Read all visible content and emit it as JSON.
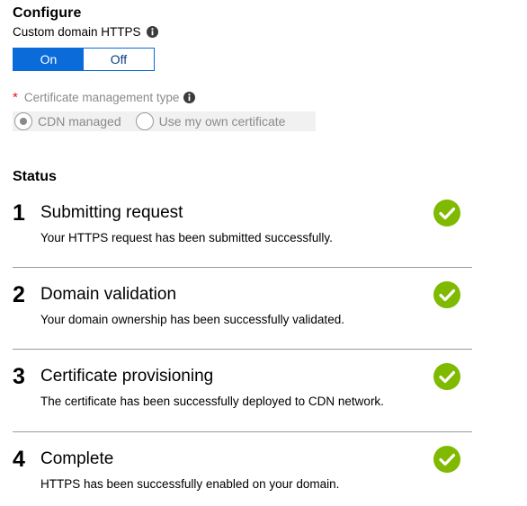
{
  "configure": {
    "title": "Configure",
    "https_label": "Custom domain HTTPS",
    "https_toggle": {
      "on_label": "On",
      "off_label": "Off",
      "selected": "On"
    },
    "cert_type_label": "Certificate management type",
    "required_marker": "*",
    "cert_options": [
      {
        "label": "CDN managed",
        "selected": true
      },
      {
        "label": "Use my own certificate",
        "selected": false
      }
    ]
  },
  "status": {
    "title": "Status",
    "steps": [
      {
        "number": "1",
        "title": "Submitting request",
        "description": "Your HTTPS request has been submitted successfully."
      },
      {
        "number": "2",
        "title": "Domain validation",
        "description": "Your domain ownership has been successfully validated."
      },
      {
        "number": "3",
        "title": "Certificate provisioning",
        "description": "The certificate has been successfully deployed to CDN network."
      },
      {
        "number": "4",
        "title": "Complete",
        "description": "HTTPS has been successfully enabled on your domain."
      }
    ]
  },
  "icons": {
    "info": "info-icon",
    "step_complete": "check-circle-icon"
  },
  "colors": {
    "toggle_active_bg": "#0a6bd9",
    "toggle_border": "#0a6bd9",
    "required_star": "#e81123",
    "check_green": "#7fba00",
    "disabled_text": "#8a8a8a",
    "divider": "#9a9a9a"
  }
}
